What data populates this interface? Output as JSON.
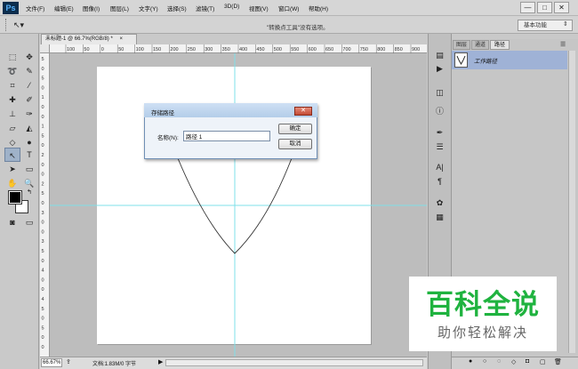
{
  "app": {
    "logo": "Ps"
  },
  "menu": [
    "文件(F)",
    "编辑(E)",
    "图像(I)",
    "图层(L)",
    "文字(Y)",
    "选择(S)",
    "滤镜(T)",
    "3D(D)",
    "视图(V)",
    "窗口(W)",
    "帮助(H)"
  ],
  "window_controls": {
    "minimize": "—",
    "maximize": "□",
    "close": "✕"
  },
  "options_bar": {
    "hint": "\"转换点工具\"没有选项。",
    "workspace": "基本功能"
  },
  "document": {
    "tab_title": "未标题-1 @ 66.7%(RGB/8) *",
    "tab_close": "×",
    "ruler_h_labels": [
      "100",
      "50",
      "0",
      "50",
      "100",
      "150",
      "200",
      "250",
      "300",
      "350",
      "400",
      "450",
      "500",
      "550",
      "600",
      "650",
      "700",
      "750",
      "800",
      "850",
      "900"
    ],
    "ruler_v_labels": [
      "5",
      "0",
      "5",
      "0",
      "1",
      "0",
      "0",
      "1",
      "5",
      "0",
      "2",
      "0",
      "0",
      "2",
      "5",
      "0",
      "3",
      "0",
      "0",
      "3",
      "5",
      "0",
      "4",
      "0",
      "0",
      "4",
      "5",
      "0",
      "5",
      "0",
      "0"
    ]
  },
  "status": {
    "zoom": "66.67%",
    "doc_info": "文档:1.83M/0 字节",
    "arrow": "▶"
  },
  "panels": {
    "tabs": [
      "图层",
      "通道",
      "路径"
    ],
    "active_tab": "路径",
    "path_name": "工作路径"
  },
  "dialog": {
    "title": "存储路径",
    "close": "✕",
    "name_label": "名称(N):",
    "name_value": "路径 1",
    "ok_label": "确定",
    "cancel_label": "取消"
  },
  "watermark": {
    "title": "百科全说",
    "subtitle": "助你轻松解决"
  },
  "colors": {
    "accent": "#1fb33f",
    "guide": "#7fe0e8",
    "selection": "#9fb2d6"
  }
}
